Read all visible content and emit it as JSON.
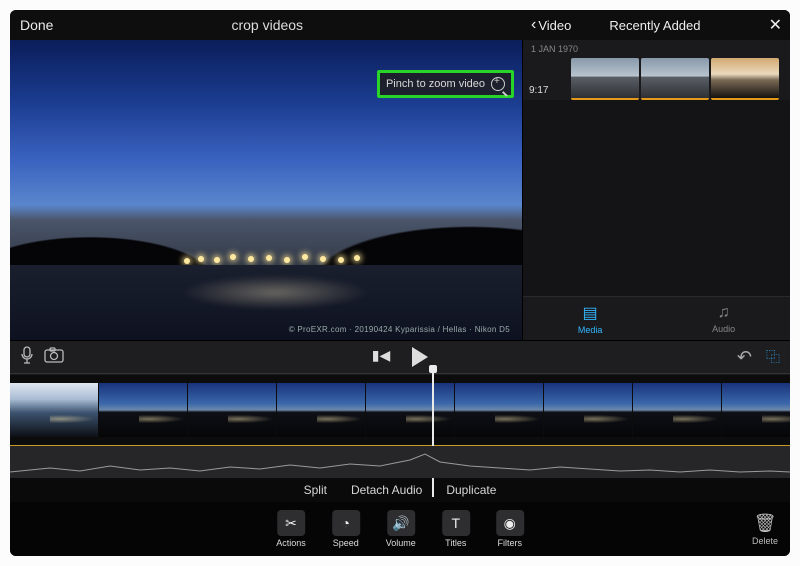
{
  "header": {
    "done": "Done",
    "title": "crop videos"
  },
  "preview": {
    "zoom_hint": "Pinch to zoom video",
    "meta": "© ProEXR.com · 20190424 Kyparissia / Hellas · Nikon D5"
  },
  "media_panel": {
    "back_label": "Video",
    "title": "Recently Added",
    "date": "1 JAN 1970",
    "clip_duration": "9:17",
    "tabs": {
      "media": "Media",
      "audio": "Audio"
    }
  },
  "actions": {
    "split": "Split",
    "detach": "Detach Audio",
    "duplicate": "Duplicate"
  },
  "tools": {
    "actions": "Actions",
    "speed": "Speed",
    "volume": "Volume",
    "titles": "Titles",
    "filters": "Filters",
    "delete": "Delete"
  }
}
